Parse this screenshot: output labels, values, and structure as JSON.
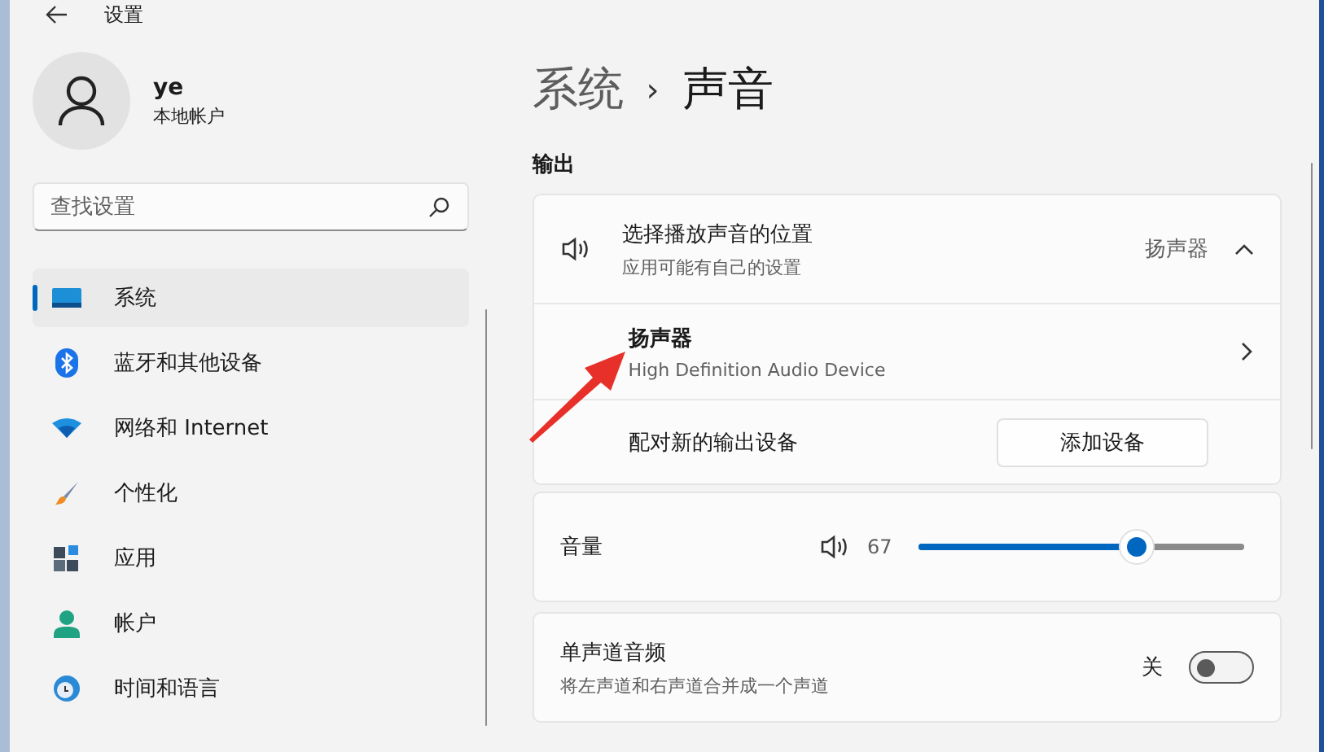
{
  "window": {
    "title": "设置"
  },
  "account": {
    "name": "ye",
    "type": "本地帐户"
  },
  "search": {
    "placeholder": "查找设置"
  },
  "sidebar": {
    "items": [
      {
        "label": "系统",
        "selected": true
      },
      {
        "label": "蓝牙和其他设备",
        "selected": false
      },
      {
        "label": "网络和 Internet",
        "selected": false
      },
      {
        "label": "个性化",
        "selected": false
      },
      {
        "label": "应用",
        "selected": false
      },
      {
        "label": "帐户",
        "selected": false
      },
      {
        "label": "时间和语言",
        "selected": false
      }
    ]
  },
  "breadcrumb": {
    "parent": "系统",
    "separator": "›",
    "current": "声音"
  },
  "output": {
    "heading": "输出",
    "choose": {
      "title": "选择播放声音的位置",
      "subtitle": "应用可能有自己的设置",
      "value": "扬声器",
      "expanded": true
    },
    "device": {
      "title": "扬声器",
      "subtitle": "High Definition Audio Device"
    },
    "pair": {
      "label": "配对新的输出设备",
      "button": "添加设备"
    },
    "volume": {
      "label": "音量",
      "reading": "67",
      "level": 0.67
    },
    "mono": {
      "title": "单声道音频",
      "subtitle": "将左声道和右声道合并成一个声道",
      "state_label": "关",
      "on": false
    }
  }
}
